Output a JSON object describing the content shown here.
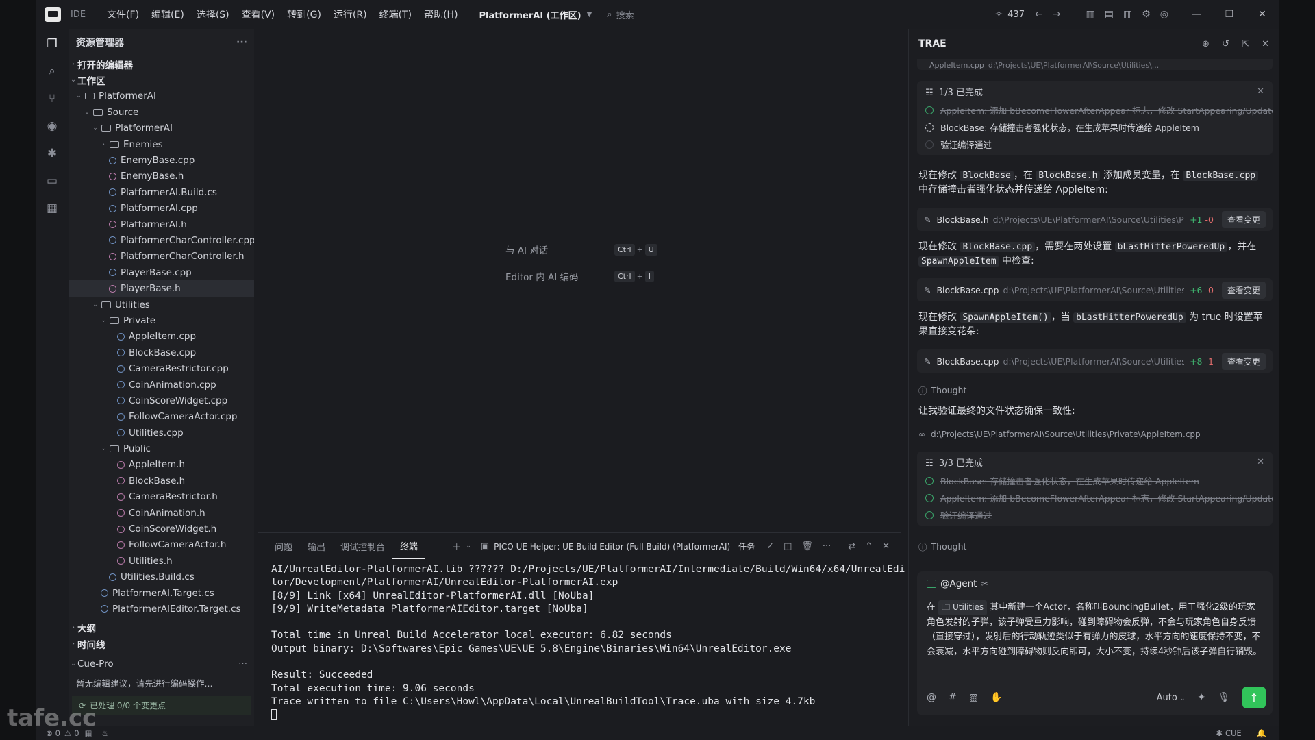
{
  "titlebar": {
    "ide_label": "IDE",
    "menu": [
      "文件(F)",
      "编辑(E)",
      "选择(S)",
      "查看(V)",
      "转到(G)",
      "运行(R)",
      "终端(T)",
      "帮助(H)"
    ],
    "project": "PlatformerAI (工作区)",
    "search_placeholder": "搜索",
    "counter": "437"
  },
  "sidebar": {
    "title": "资源管理器",
    "open_editors": "打开的编辑器",
    "workspace": "工作区",
    "tree": [
      {
        "label": "PlatformerAI",
        "type": "folder",
        "depth": 0,
        "open": true
      },
      {
        "label": "Source",
        "type": "folder",
        "depth": 1,
        "open": true
      },
      {
        "label": "PlatformerAI",
        "type": "folder",
        "depth": 2,
        "open": true
      },
      {
        "label": "Enemies",
        "type": "folder",
        "depth": 3,
        "open": false
      },
      {
        "label": "EnemyBase.cpp",
        "type": "cpp",
        "depth": 3
      },
      {
        "label": "EnemyBase.h",
        "type": "h",
        "depth": 3
      },
      {
        "label": "PlatformerAI.Build.cs",
        "type": "cpp",
        "depth": 3
      },
      {
        "label": "PlatformerAI.cpp",
        "type": "cpp",
        "depth": 3
      },
      {
        "label": "PlatformerAI.h",
        "type": "h",
        "depth": 3
      },
      {
        "label": "PlatformerCharController.cpp",
        "type": "cpp",
        "depth": 3
      },
      {
        "label": "PlatformerCharController.h",
        "type": "h",
        "depth": 3
      },
      {
        "label": "PlayerBase.cpp",
        "type": "cpp",
        "depth": 3
      },
      {
        "label": "PlayerBase.h",
        "type": "h",
        "depth": 3,
        "selected": true
      },
      {
        "label": "Utilities",
        "type": "folder",
        "depth": 2,
        "open": true
      },
      {
        "label": "Private",
        "type": "folder",
        "depth": 3,
        "open": true
      },
      {
        "label": "AppleItem.cpp",
        "type": "cpp",
        "depth": 4
      },
      {
        "label": "BlockBase.cpp",
        "type": "cpp",
        "depth": 4
      },
      {
        "label": "CameraRestrictor.cpp",
        "type": "cpp",
        "depth": 4
      },
      {
        "label": "CoinAnimation.cpp",
        "type": "cpp",
        "depth": 4
      },
      {
        "label": "CoinScoreWidget.cpp",
        "type": "cpp",
        "depth": 4
      },
      {
        "label": "FollowCameraActor.cpp",
        "type": "cpp",
        "depth": 4
      },
      {
        "label": "Utilities.cpp",
        "type": "cpp",
        "depth": 4
      },
      {
        "label": "Public",
        "type": "folder",
        "depth": 3,
        "open": true
      },
      {
        "label": "AppleItem.h",
        "type": "h",
        "depth": 4
      },
      {
        "label": "BlockBase.h",
        "type": "h",
        "depth": 4
      },
      {
        "label": "CameraRestrictor.h",
        "type": "h",
        "depth": 4
      },
      {
        "label": "CoinAnimation.h",
        "type": "h",
        "depth": 4
      },
      {
        "label": "CoinScoreWidget.h",
        "type": "h",
        "depth": 4
      },
      {
        "label": "FollowCameraActor.h",
        "type": "h",
        "depth": 4
      },
      {
        "label": "Utilities.h",
        "type": "h",
        "depth": 4
      },
      {
        "label": "Utilities.Build.cs",
        "type": "cpp",
        "depth": 3
      },
      {
        "label": "PlatformerAI.Target.cs",
        "type": "cpp",
        "depth": 2
      },
      {
        "label": "PlatformerAIEditor.Target.cs",
        "type": "cpp",
        "depth": 2
      }
    ],
    "outline": "大纲",
    "timeline": "时间线",
    "cue_pro": "Cue-Pro",
    "cue_message": "暂无编辑建议，请先进行编码操作...",
    "cue_status": "已处理 0/0 个变更点"
  },
  "editor": {
    "hint1_label": "与 AI 对话",
    "hint1_keys": [
      "Ctrl",
      "U"
    ],
    "hint2_label": "Editor 内 AI 编码",
    "hint2_keys": [
      "Ctrl",
      "I"
    ]
  },
  "panel": {
    "tabs": [
      "问题",
      "输出",
      "调试控制台",
      "终端"
    ],
    "active_tab": "终端",
    "task": "PICO UE Helper: UE Build Editor (Full Build) (PlatformerAI) - 任务",
    "terminal_lines": [
      "AI/UnrealEditor-PlatformerAI.lib ?????? D:/Projects/UE/PlatformerAI/Intermediate/Build/Win64/x64/UnrealEdi",
      "tor/Development/PlatformerAI/UnrealEditor-PlatformerAI.exp",
      "[8/9] Link [x64] UnrealEditor-PlatformerAI.dll [NoUba]",
      "[9/9] WriteMetadata PlatformerAIEditor.target [NoUba]",
      "",
      "Total time in Unreal Build Accelerator local executor: 6.82 seconds",
      "Output binary: D:\\Softwares\\Epic Games\\UE\\UE_5.8\\Engine\\Binaries\\Win64\\UnrealEditor.exe",
      "",
      "Result: Succeeded",
      "Total execution time: 9.06 seconds",
      "Trace written to file C:\\Users\\Howl\\AppData\\Local\\UnrealBuildTool\\Trace.uba with size 4.7kb"
    ]
  },
  "trae": {
    "title": "TRAE",
    "top_file": "AppleItem.cpp",
    "top_file_path": "d:\\Projects\\UE\\PlatformerAI\\Source\\Utilities\\...",
    "todo1": {
      "header": "1/3 已完成",
      "items": [
        {
          "text": "AppleItem: 添加 bBecomeFlowerAfterAppear 标志，修改 StartAppearing/Update...",
          "state": "done"
        },
        {
          "text": "BlockBase: 存储撞击者强化状态，在生成苹果时传递给 AppleItem",
          "state": "progress"
        },
        {
          "text": "验证编译通过",
          "state": "none"
        }
      ]
    },
    "msg1_a": "现在修改 ",
    "msg1_code1": "BlockBase",
    "msg1_b": "，在 ",
    "msg1_code2": "BlockBase.h",
    "msg1_c": " 添加成员变量，在 ",
    "msg1_code3": "BlockBase.cpp",
    "msg1_d": " 中存储撞击者强化状态并传递给 AppleItem:",
    "file1": {
      "name": "BlockBase.h",
      "path": "d:\\Projects\\UE\\PlatformerAI\\Source\\Utilities\\Publ...",
      "add": "+1",
      "del": "-0"
    },
    "msg2_a": "现在修改 ",
    "msg2_code1": "BlockBase.cpp",
    "msg2_b": "，需要在两处设置 ",
    "msg2_code2": "bLastHitterPoweredUp",
    "msg2_c": "，并在 ",
    "msg2_code3": "SpawnAppleItem",
    "msg2_d": " 中检查:",
    "file2": {
      "name": "BlockBase.cpp",
      "path": "d:\\Projects\\UE\\PlatformerAI\\Source\\Utilities\\Pr...",
      "add": "+6",
      "del": "-0"
    },
    "msg3_a": "现在修改 ",
    "msg3_code1": "SpawnAppleItem()",
    "msg3_b": "，当 ",
    "msg3_code2": "bLastHitterPoweredUp",
    "msg3_c": " 为 true 时设置苹果直接变花朵:",
    "file3": {
      "name": "BlockBase.cpp",
      "path": "d:\\Projects\\UE\\PlatformerAI\\Source\\Utilities\\Pr...",
      "add": "+8",
      "del": "-1"
    },
    "view_changes": "查看变更",
    "thought": "Thought",
    "msg4": "让我验证最终的文件状态确保一致性:",
    "read_path": "d:\\Projects\\UE\\PlatformerAI\\Source\\Utilities\\Private\\AppleItem.cpp",
    "todo2": {
      "header": "3/3 已完成",
      "items": [
        {
          "text": "BlockBase: 存储撞击者强化状态，在生成苹果时传递给 AppleItem",
          "state": "done"
        },
        {
          "text": "AppleItem: 添加 bBecomeFlowerAfterAppear 标志，修改 StartAppearing/Update...",
          "state": "done"
        },
        {
          "text": "验证编译通过",
          "state": "done"
        }
      ]
    },
    "agent": "@Agent",
    "prompt_a": "在 ",
    "prompt_chip": "Utilities",
    "prompt_b": " 其中新建一个Actor，名称叫BouncingBullet，用于强化2级的玩家角色发射的子弹，该子弹受重力影响，碰到障碍物会反弹，不会与玩家角色自身反馈（直接穿过），发射后的行动轨迹类似于有弹力的皮球，水平方向的速度保持不变，不会衰减，水平方向碰到障碍物则反向即可，大小不变，持续4秒钟后该子弹自行销毁。",
    "mode": "Auto"
  },
  "statusbar": {
    "errors": "0",
    "warnings": "0",
    "cue": "CUE"
  },
  "watermark": "tafe.cc"
}
